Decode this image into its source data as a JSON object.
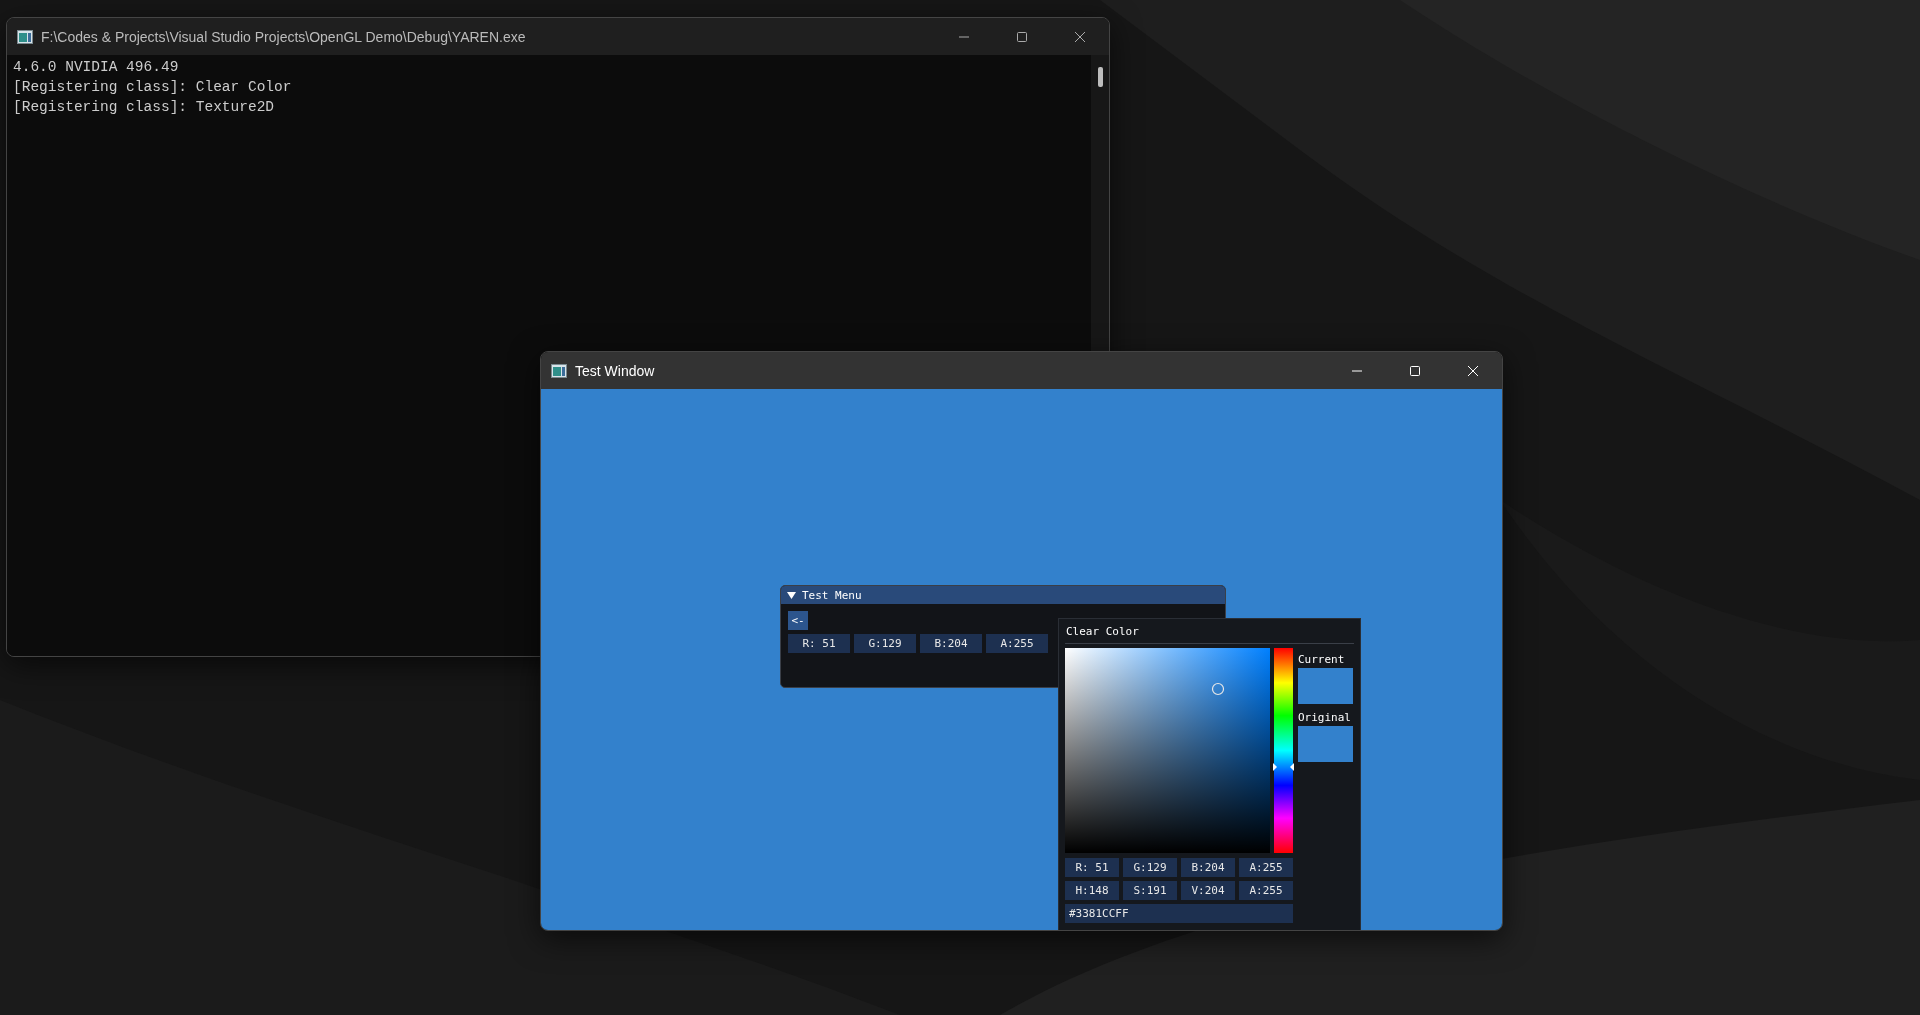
{
  "console_window": {
    "title": "F:\\Codes & Projects\\Visual Studio Projects\\OpenGL Demo\\Debug\\YAREN.exe",
    "lines": [
      "4.6.0 NVIDIA 496.49",
      "[Registering class]: Clear Color",
      "[Registering class]: Texture2D"
    ]
  },
  "test_window": {
    "title": "Test Window"
  },
  "test_menu": {
    "title": "Test Menu",
    "expanded": true,
    "back_button": "<-",
    "fields": [
      "R: 51",
      "G:129",
      "B:204",
      "A:255"
    ]
  },
  "color_picker": {
    "title": "Clear Color",
    "hue_bar": {
      "level": 0.58
    },
    "swatches": [
      {
        "label": "Current",
        "color": "#3381cc"
      },
      {
        "label": "Original",
        "color": "#3381cc"
      }
    ],
    "field_rows": [
      [
        "R: 51",
        "G:129",
        "B:204",
        "A:255"
      ],
      [
        "H:148",
        "S:191",
        "V:204",
        "A:255"
      ]
    ],
    "hex_field": "#3381CCFF"
  }
}
